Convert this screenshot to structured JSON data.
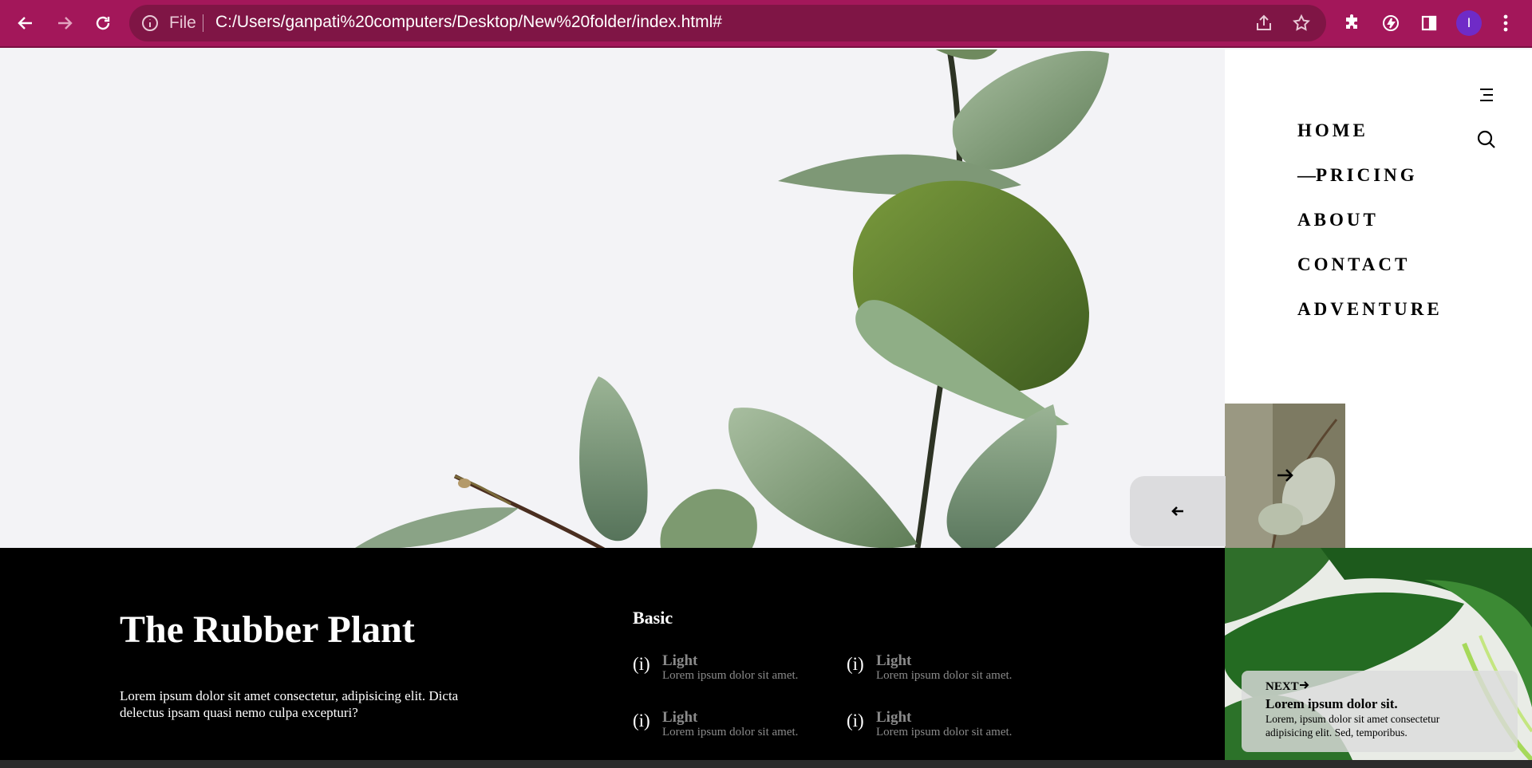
{
  "browser": {
    "info_label": "File",
    "url": "C:/Users/ganpati%20computers/Desktop/New%20folder/index.html#",
    "profile_initial": "I",
    "accent": "#a3175a"
  },
  "nav": {
    "items": [
      {
        "label": "HOME"
      },
      {
        "label": "PRICING",
        "active_marker": "—"
      },
      {
        "label": "ABOUT"
      },
      {
        "label": "CONTACT"
      },
      {
        "label": "ADVENTURE"
      }
    ]
  },
  "icons": {
    "menu": "hamburger-menu-icon",
    "search": "search-icon",
    "prev": "arrow-left-icon",
    "next": "arrow-right-icon"
  },
  "product": {
    "title": "The Rubber Plant",
    "description": "Lorem ipsum dolor sit amet consectetur, adipisicing elit. Dicta delectus ipsam quasi nemo culpa excepturi?"
  },
  "plan": {
    "heading": "Basic",
    "features": [
      {
        "icon": "(i)",
        "name": "Light",
        "desc": "Lorem ipsum dolor sit amet."
      },
      {
        "icon": "(i)",
        "name": "Light",
        "desc": "Lorem ipsum dolor sit amet."
      },
      {
        "icon": "(i)",
        "name": "Light",
        "desc": "Lorem ipsum dolor sit amet."
      },
      {
        "icon": "(i)",
        "name": "Light",
        "desc": "Lorem ipsum dolor sit amet."
      }
    ]
  },
  "next_card": {
    "label": "NEXT",
    "title": "Lorem ipsum dolor sit.",
    "desc": "Lorem, ipsum dolor sit amet consectetur adipisicing elit. Sed, temporibus."
  }
}
